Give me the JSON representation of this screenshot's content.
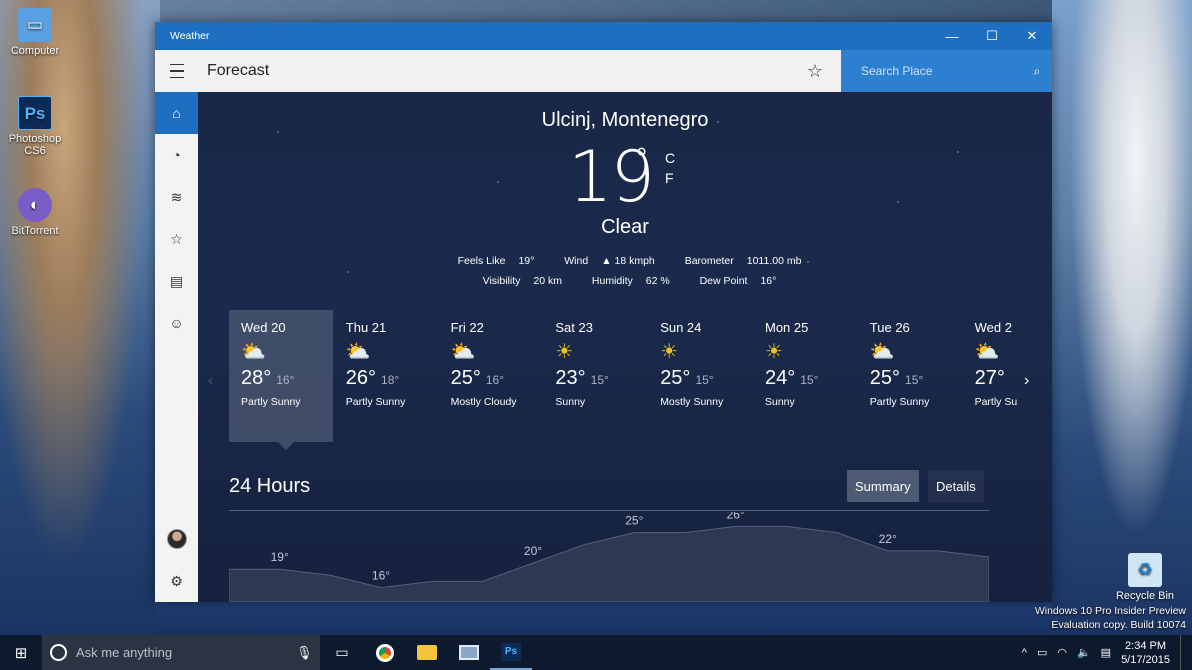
{
  "desktop": {
    "icons": [
      {
        "label": "Computer",
        "glyph": "▭"
      },
      {
        "label": "Photoshop CS6",
        "glyph": "Ps"
      },
      {
        "label": "BitTorrent",
        "glyph": "◐"
      },
      {
        "label": "Recycle Bin",
        "glyph": "♻"
      }
    ],
    "notice_line1": "Windows 10 Pro Insider Preview",
    "notice_line2": "Evaluation copy. Build 10074"
  },
  "window": {
    "title": "Weather",
    "page_title": "Forecast",
    "search_placeholder": "Search Place"
  },
  "sidebar": {
    "items": [
      {
        "icon": "home-icon",
        "glyph": "⌂"
      },
      {
        "icon": "radar-icon",
        "glyph": "◔"
      },
      {
        "icon": "historical-chart-icon",
        "glyph": "≋"
      },
      {
        "icon": "favorites-star-icon",
        "glyph": "☆"
      },
      {
        "icon": "news-icon",
        "glyph": "▤"
      },
      {
        "icon": "smiley-icon",
        "glyph": "☺"
      }
    ],
    "settings_glyph": "⚙"
  },
  "current": {
    "location": "Ulcinj, Montenegro",
    "temperature": "19",
    "degree": "°",
    "unit_c": "C",
    "unit_f": "F",
    "condition": "Clear",
    "feels_like_label": "Feels Like",
    "feels_like": "19°",
    "wind_label": "Wind",
    "wind": "▲ 18 kmph",
    "barometer_label": "Barometer",
    "barometer": "1011.00 mb",
    "visibility_label": "Visibility",
    "visibility": "20 km",
    "humidity_label": "Humidity",
    "humidity": "62 %",
    "dew_point_label": "Dew Point",
    "dew_point": "16°"
  },
  "forecast": [
    {
      "day": "Wed 20",
      "hi": "28°",
      "lo": "16°",
      "desc": "Partly Sunny",
      "icon": "partly-sunny-icon",
      "glyph": "⛅",
      "selected": true
    },
    {
      "day": "Thu 21",
      "hi": "26°",
      "lo": "18°",
      "desc": "Partly Sunny",
      "icon": "partly-sunny-icon",
      "glyph": "⛅",
      "selected": false
    },
    {
      "day": "Fri 22",
      "hi": "25°",
      "lo": "16°",
      "desc": "Mostly Cloudy",
      "icon": "mostly-cloudy-icon",
      "glyph": "⛅",
      "selected": false
    },
    {
      "day": "Sat 23",
      "hi": "23°",
      "lo": "15°",
      "desc": "Sunny",
      "icon": "sunny-icon",
      "glyph": "☀",
      "selected": false
    },
    {
      "day": "Sun 24",
      "hi": "25°",
      "lo": "15°",
      "desc": "Mostly Sunny",
      "icon": "mostly-sunny-icon",
      "glyph": "☀",
      "selected": false
    },
    {
      "day": "Mon 25",
      "hi": "24°",
      "lo": "15°",
      "desc": "Sunny",
      "icon": "sunny-icon",
      "glyph": "☀",
      "selected": false
    },
    {
      "day": "Tue 26",
      "hi": "25°",
      "lo": "15°",
      "desc": "Partly Sunny",
      "icon": "partly-sunny-icon",
      "glyph": "⛅",
      "selected": false
    },
    {
      "day": "Wed 2",
      "hi": "27°",
      "lo": "",
      "desc": "Partly Su",
      "icon": "partly-sunny-icon",
      "glyph": "⛅",
      "selected": false
    }
  ],
  "hours": {
    "title": "24 Hours",
    "tab_summary": "Summary",
    "tab_details": "Details"
  },
  "chart_data": {
    "type": "area",
    "title": "",
    "labels": [
      "19°",
      "16°",
      "20°",
      "25°",
      "26°",
      "22°"
    ],
    "points": [
      19,
      19,
      18,
      16,
      17,
      17,
      20,
      23,
      25,
      25,
      26,
      26,
      25,
      22,
      22,
      21
    ]
  },
  "taskbar": {
    "search_placeholder": "Ask me anything",
    "time": "2:34 PM",
    "date": "5/17/2015"
  }
}
